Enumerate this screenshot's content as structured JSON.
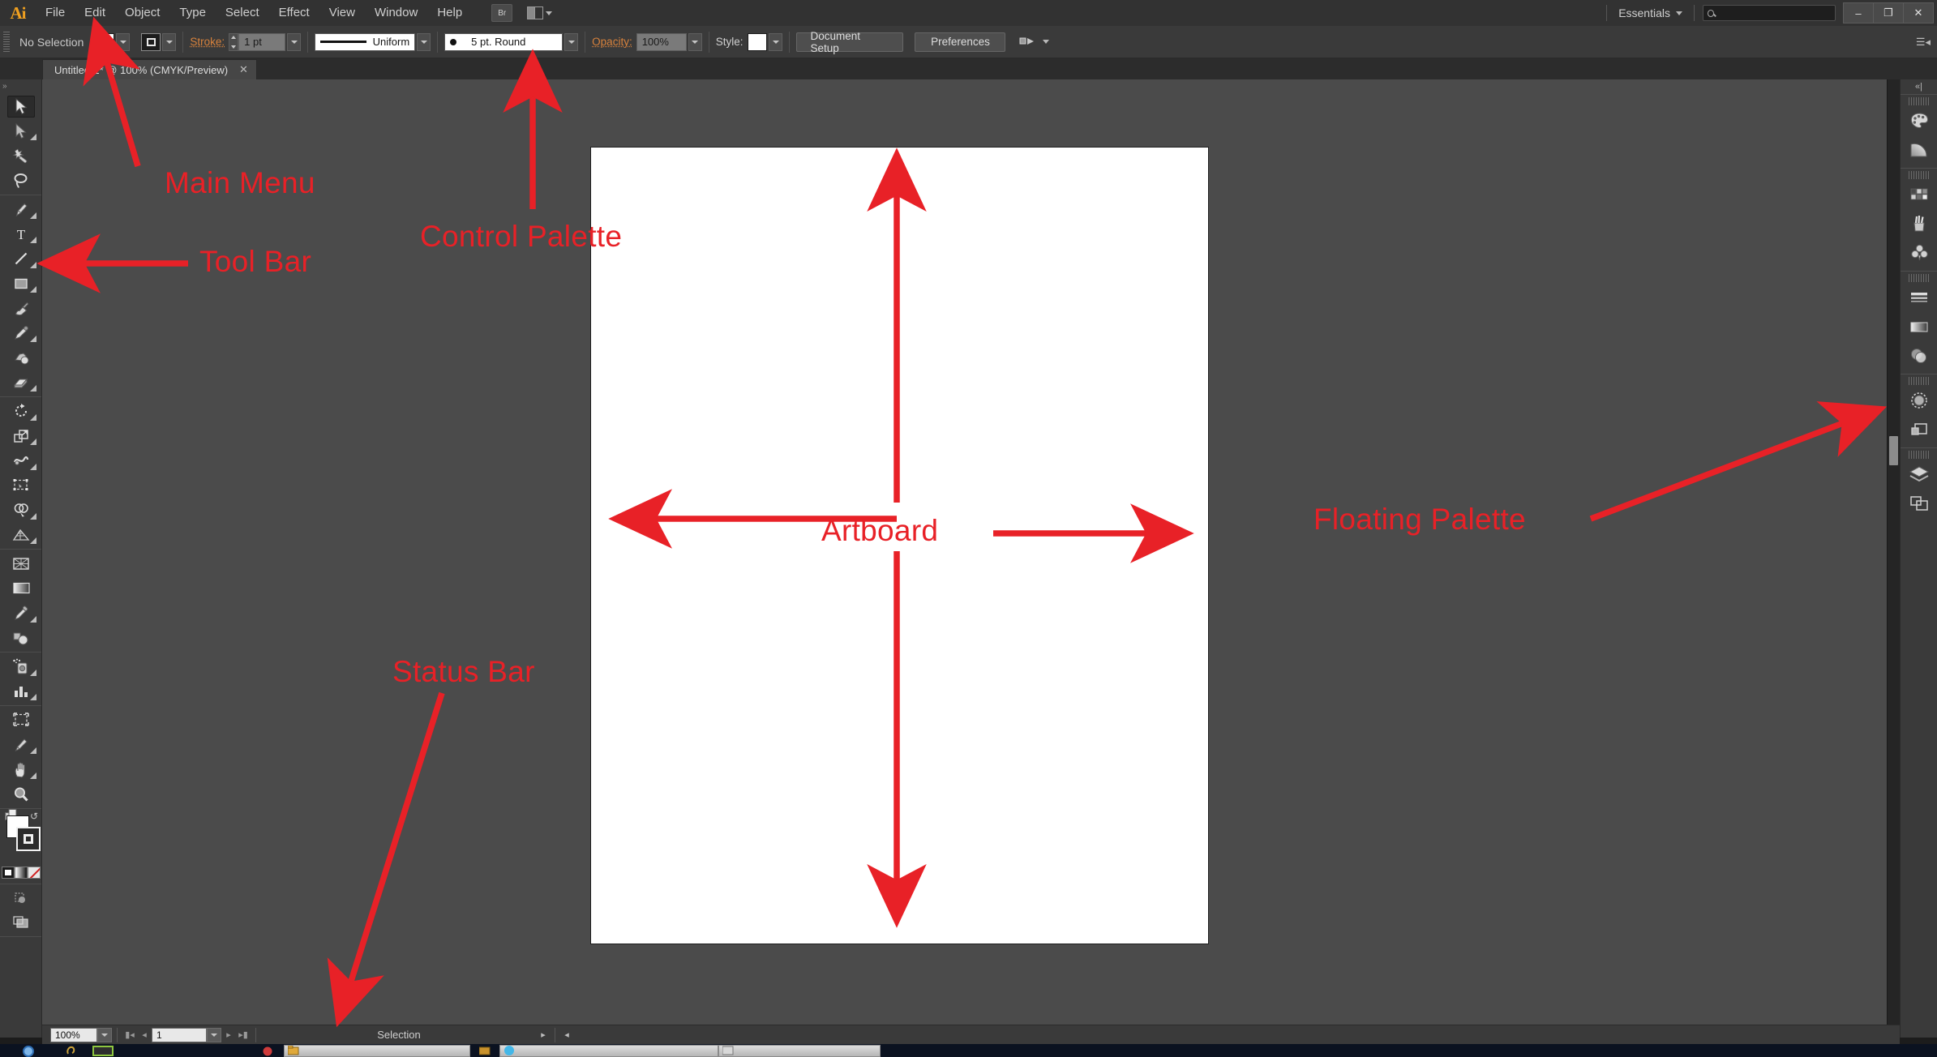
{
  "app": {
    "name": "Ai",
    "logo_color": "#f0a020"
  },
  "menubar": {
    "items": [
      {
        "label": "File"
      },
      {
        "label": "Edit"
      },
      {
        "label": "Object"
      },
      {
        "label": "Type"
      },
      {
        "label": "Select"
      },
      {
        "label": "Effect"
      },
      {
        "label": "View"
      },
      {
        "label": "Window"
      },
      {
        "label": "Help"
      }
    ],
    "bridge_label": "Br",
    "arrange_label": "",
    "workspace": "Essentials",
    "search_placeholder": "",
    "search_value": "",
    "window_buttons": {
      "minimize": "–",
      "maximize": "❐",
      "close": "✕"
    }
  },
  "control_palette": {
    "selection_status": "No Selection",
    "stroke_label": "Stroke:",
    "stroke_weight": "1 pt",
    "profile": "Uniform",
    "brush": "5 pt. Round",
    "opacity_label": "Opacity:",
    "opacity_value": "100%",
    "style_label": "Style:",
    "document_setup_button": "Document Setup",
    "preferences_button": "Preferences"
  },
  "document_tab": {
    "title": "Untitled-1* @ 100% (CMYK/Preview)",
    "close_glyph": "✕"
  },
  "toolbar": {
    "tools": [
      {
        "name": "selection-tool",
        "label": "Selection",
        "active": true,
        "more": false
      },
      {
        "name": "direct-selection-tool",
        "label": "Direct Selection",
        "active": false,
        "more": true
      },
      {
        "name": "magic-wand-tool",
        "label": "Magic Wand",
        "active": false,
        "more": false
      },
      {
        "name": "lasso-tool",
        "label": "Lasso",
        "active": false,
        "more": false
      },
      {
        "name": "pen-tool",
        "label": "Pen",
        "active": false,
        "more": true
      },
      {
        "name": "type-tool",
        "label": "Type",
        "active": false,
        "more": true
      },
      {
        "name": "line-segment-tool",
        "label": "Line Segment",
        "active": false,
        "more": true
      },
      {
        "name": "rectangle-tool",
        "label": "Rectangle",
        "active": false,
        "more": true
      },
      {
        "name": "paintbrush-tool",
        "label": "Paintbrush",
        "active": false,
        "more": false
      },
      {
        "name": "pencil-tool",
        "label": "Pencil",
        "active": false,
        "more": true
      },
      {
        "name": "blob-brush-tool",
        "label": "Blob Brush",
        "active": false,
        "more": false
      },
      {
        "name": "eraser-tool",
        "label": "Eraser",
        "active": false,
        "more": true
      },
      {
        "name": "rotate-tool",
        "label": "Rotate",
        "active": false,
        "more": true
      },
      {
        "name": "scale-tool",
        "label": "Scale",
        "active": false,
        "more": true
      },
      {
        "name": "width-warp-tool",
        "label": "Width / Warp",
        "active": false,
        "more": true
      },
      {
        "name": "free-transform-tool",
        "label": "Free Transform",
        "active": false,
        "more": false
      },
      {
        "name": "shape-builder-tool",
        "label": "Shape Builder",
        "active": false,
        "more": true
      },
      {
        "name": "perspective-grid-tool",
        "label": "Perspective Grid",
        "active": false,
        "more": true
      },
      {
        "name": "mesh-tool",
        "label": "Mesh",
        "active": false,
        "more": false
      },
      {
        "name": "gradient-tool",
        "label": "Gradient",
        "active": false,
        "more": false
      },
      {
        "name": "eyedropper-tool",
        "label": "Eyedropper",
        "active": false,
        "more": true
      },
      {
        "name": "blend-tool",
        "label": "Blend",
        "active": false,
        "more": false
      },
      {
        "name": "symbol-sprayer-tool",
        "label": "Symbol Sprayer",
        "active": false,
        "more": true
      },
      {
        "name": "column-graph-tool",
        "label": "Column Graph",
        "active": false,
        "more": true
      },
      {
        "name": "artboard-tool",
        "label": "Artboard",
        "active": false,
        "more": false
      },
      {
        "name": "slice-tool",
        "label": "Slice",
        "active": false,
        "more": true
      },
      {
        "name": "hand-tool",
        "label": "Hand",
        "active": false,
        "more": true
      },
      {
        "name": "zoom-tool",
        "label": "Zoom",
        "active": false,
        "more": false
      }
    ],
    "fill_color": "#ffffff",
    "stroke_color": "#000000",
    "screen_mode_label": ""
  },
  "right_dock": {
    "groups": [
      {
        "icons": [
          {
            "name": "color-panel-icon",
            "label": "Color"
          },
          {
            "name": "color-guide-panel-icon",
            "label": "Color Guide"
          }
        ]
      },
      {
        "icons": [
          {
            "name": "swatches-panel-icon",
            "label": "Swatches"
          },
          {
            "name": "brushes-panel-icon",
            "label": "Brushes"
          },
          {
            "name": "symbols-panel-icon",
            "label": "Symbols"
          }
        ]
      },
      {
        "icons": [
          {
            "name": "stroke-panel-icon",
            "label": "Stroke"
          },
          {
            "name": "gradient-panel-icon",
            "label": "Gradient"
          },
          {
            "name": "transparency-panel-icon",
            "label": "Transparency"
          }
        ]
      },
      {
        "icons": [
          {
            "name": "appearance-panel-icon",
            "label": "Appearance"
          },
          {
            "name": "graphic-styles-panel-icon",
            "label": "Graphic Styles"
          }
        ]
      },
      {
        "icons": [
          {
            "name": "layers-panel-icon",
            "label": "Layers"
          },
          {
            "name": "artboards-panel-icon",
            "label": "Artboards"
          }
        ]
      }
    ]
  },
  "statusbar": {
    "zoom_level": "100%",
    "page_number": "1",
    "status_text": "Selection"
  },
  "annotations": {
    "color": "#e82127",
    "labels": [
      {
        "id": "main-menu",
        "text": "Main Menu"
      },
      {
        "id": "tool-bar",
        "text": "Tool Bar"
      },
      {
        "id": "control-palette",
        "text": "Control Palette"
      },
      {
        "id": "artboard",
        "text": "Artboard"
      },
      {
        "id": "floating-palette",
        "text": "Floating Palette"
      },
      {
        "id": "status-bar",
        "text": "Status Bar"
      }
    ]
  }
}
